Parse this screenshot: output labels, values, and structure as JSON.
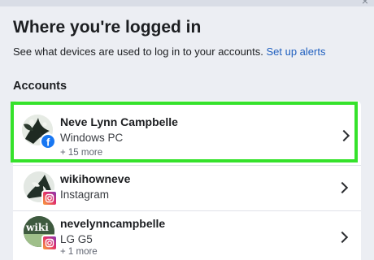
{
  "header": {
    "title": "Where you're logged in",
    "subtitle": "See what devices are used to log in to your accounts.",
    "setup_link": "Set up alerts",
    "close_glyph": "×"
  },
  "accounts": {
    "section_label": "Accounts",
    "items": [
      {
        "name": "Neve Lynn Campbelle",
        "platform": "Windows PC",
        "more": "+ 15 more",
        "badge_icon": "facebook-icon",
        "chevron_icon": "chevron-right-icon"
      },
      {
        "name": "wikihowneve",
        "platform": "Instagram",
        "badge_icon": "instagram-icon",
        "chevron_icon": "chevron-right-icon"
      },
      {
        "name": "nevelynncampbelle",
        "platform": "LG G5",
        "more": "+ 1 more",
        "badge_icon": "instagram-icon",
        "avatar_text": "wiki",
        "chevron_icon": "chevron-right-icon"
      }
    ]
  },
  "colors": {
    "highlight": "#35e22b",
    "link": "#1f5fbf",
    "facebook": "#1877f2",
    "background": "#eceef3"
  }
}
